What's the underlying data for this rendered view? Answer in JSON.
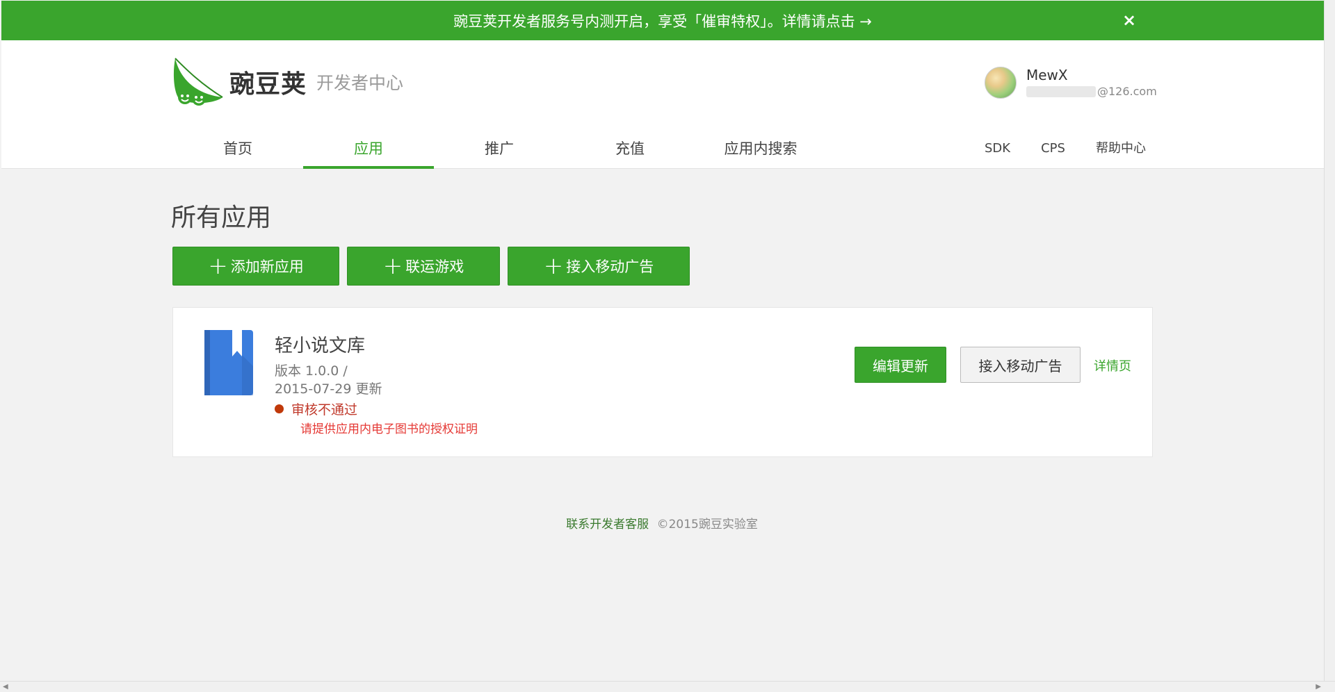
{
  "banner": {
    "text": "豌豆荚开发者服务号内测开启，享受「催审特权」。详情请点击 →",
    "close": "×"
  },
  "header": {
    "logo_name": "豌豆荚",
    "logo_sub": "开发者中心",
    "user_name": "MewX",
    "user_email_suffix": "@126.com",
    "nav": [
      "首页",
      "应用",
      "推广",
      "充值",
      "应用内搜索"
    ],
    "nav_active": "应用",
    "nav_right": [
      "SDK",
      "CPS",
      "帮助中心"
    ]
  },
  "main": {
    "title": "所有应用",
    "buttons": {
      "add_app": "添加新应用",
      "joint_game": "联运游戏",
      "mobile_ads": "接入移动广告"
    },
    "app": {
      "name": "轻小说文库",
      "version": "版本 1.0.0  /",
      "date": "2015-07-29 更新",
      "status": "审核不通过",
      "reason": "请提供应用内电子图书的授权证明",
      "edit_btn": "编辑更新",
      "ad_btn": "接入移动广告",
      "detail_link": "详情页"
    }
  },
  "footer": {
    "link": "联系开发者客服",
    "copyright": "©2015豌豆实验室"
  },
  "colors": {
    "brand_green": "#3aa52d",
    "error_red": "#e53935",
    "app_icon_blue": "#3b7ddd"
  }
}
